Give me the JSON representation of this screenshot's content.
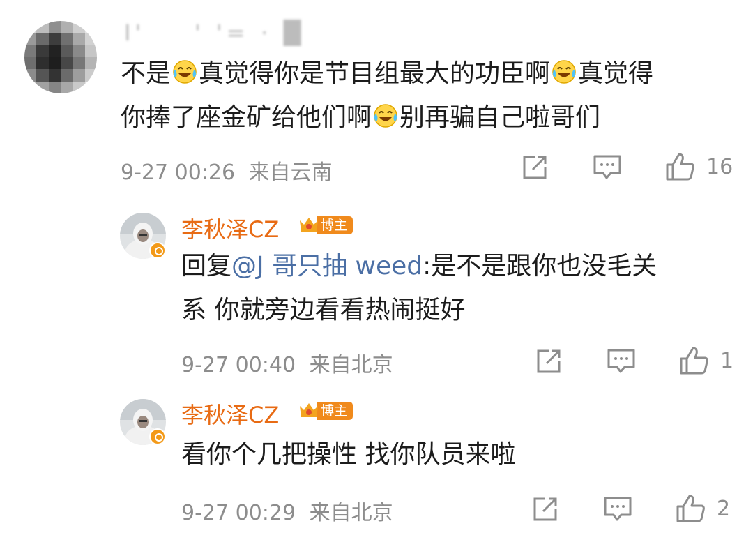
{
  "comments": [
    {
      "author": "I'   ' '= · █",
      "segments": [
        {
          "text": "不是"
        },
        {
          "emoji": "laugh-cry"
        },
        {
          "text": "真觉得你是节目组最大的功臣啊"
        },
        {
          "emoji": "laugh-cry"
        },
        {
          "text": "真觉得"
        }
      ],
      "segments2": [
        {
          "text": "你捧了座金矿给他们啊"
        },
        {
          "emoji": "laugh-cry"
        },
        {
          "text": "别再骗自己啦哥们"
        }
      ],
      "time": "9-27 00:26",
      "location": "来自云南",
      "likes": "16"
    },
    {
      "author": "李秋泽CZ",
      "badge": "博主",
      "reply_prefix": "回复",
      "mention": "@J 哥只抽 weed",
      "line1_rest": ":是不是跟你也没毛关",
      "line2": "系 你就旁边看看热闹挺好",
      "time": "9-27 00:40",
      "location": "来自北京",
      "likes": "1"
    },
    {
      "author": "李秋泽CZ",
      "badge": "博主",
      "line1": "看你个几把操性 找你队员来啦",
      "time": "9-27 00:29",
      "location": "来自北京",
      "likes": "2"
    }
  ],
  "colors": {
    "host_name": "#e86b14",
    "mention": "#4b6fa5",
    "meta": "#8d8d8d",
    "badge": "#f08a1c"
  },
  "icons": [
    "share-icon",
    "comment-icon",
    "like-icon",
    "crown-icon",
    "verified-icon",
    "laugh-cry-emoji"
  ]
}
